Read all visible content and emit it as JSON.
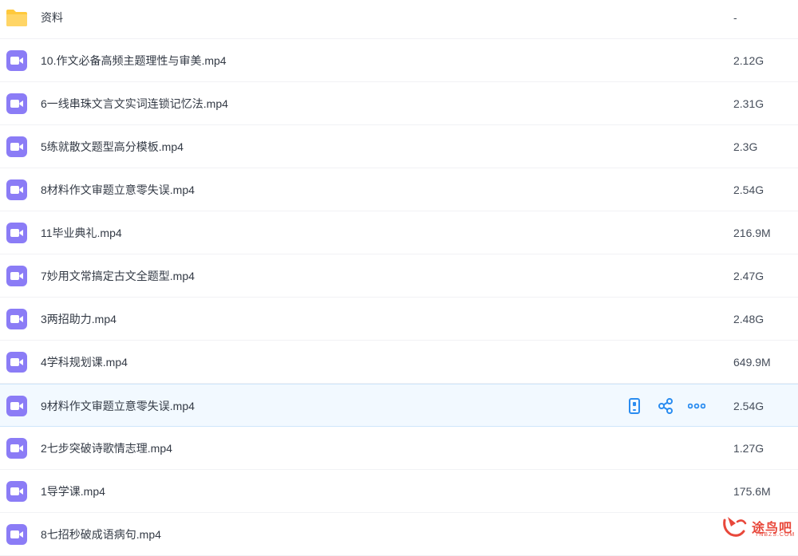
{
  "files": [
    {
      "name": "资料",
      "size": "-",
      "type": "folder"
    },
    {
      "name": "10.作文必备高频主题理性与审美.mp4",
      "size": "2.12G",
      "type": "video"
    },
    {
      "name": "6一线串珠文言文实词连锁记忆法.mp4",
      "size": "2.31G",
      "type": "video"
    },
    {
      "name": "5练就散文题型高分模板.mp4",
      "size": "2.3G",
      "type": "video"
    },
    {
      "name": "8材料作文审题立意零失误.mp4",
      "size": "2.54G",
      "type": "video"
    },
    {
      "name": "11毕业典礼.mp4",
      "size": "216.9M",
      "type": "video"
    },
    {
      "name": "7妙用文常搞定古文全题型.mp4",
      "size": "2.47G",
      "type": "video"
    },
    {
      "name": "3两招助力.mp4",
      "size": "2.48G",
      "type": "video"
    },
    {
      "name": "4学科规划课.mp4",
      "size": "649.9M",
      "type": "video"
    },
    {
      "name": "9材料作文审题立意零失误.mp4",
      "size": "2.54G",
      "type": "video",
      "hovered": true
    },
    {
      "name": "2七步突破诗歌情志理.mp4",
      "size": "1.27G",
      "type": "video"
    },
    {
      "name": "1导学课.mp4",
      "size": "175.6M",
      "type": "video"
    },
    {
      "name": "8七招秒破成语病句.mp4",
      "size": "",
      "type": "video"
    }
  ],
  "icons": {
    "folder": "folder-icon",
    "video": "video-file-icon",
    "row_actions": [
      "phone-icon",
      "share-icon",
      "more-icon"
    ]
  },
  "colors": {
    "folder": "#ffc93c",
    "video": "#8b7cf6",
    "action": "#2a8cf0",
    "hover_bg": "#f2f9ff"
  },
  "watermark": {
    "text": "途鸟吧",
    "sub": "TNBZS.COM"
  }
}
